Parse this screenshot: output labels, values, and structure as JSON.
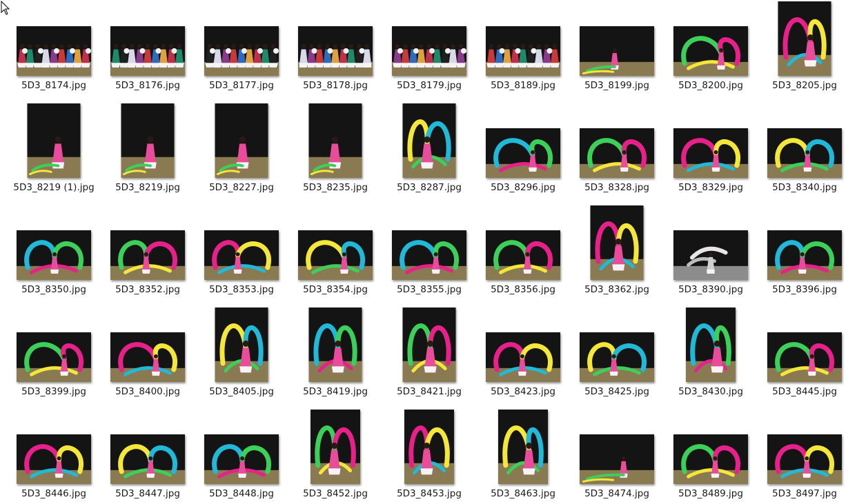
{
  "files": [
    {
      "name": "5D3_8174.jpg",
      "orient": "land",
      "scene": "group"
    },
    {
      "name": "5D3_8176.jpg",
      "orient": "land",
      "scene": "group"
    },
    {
      "name": "5D3_8177.jpg",
      "orient": "land",
      "scene": "group"
    },
    {
      "name": "5D3_8178.jpg",
      "orient": "land",
      "scene": "group"
    },
    {
      "name": "5D3_8179.jpg",
      "orient": "land",
      "scene": "group"
    },
    {
      "name": "5D3_8189.jpg",
      "orient": "land",
      "scene": "group"
    },
    {
      "name": "5D3_8199.jpg",
      "orient": "land",
      "scene": "solo"
    },
    {
      "name": "5D3_8200.jpg",
      "orient": "land",
      "scene": "ribbon"
    },
    {
      "name": "5D3_8205.jpg",
      "orient": "port",
      "scene": "ribbon"
    },
    {
      "name": "5D3_8219 (1).jpg",
      "orient": "port",
      "scene": "solo"
    },
    {
      "name": "5D3_8219.jpg",
      "orient": "port",
      "scene": "solo"
    },
    {
      "name": "5D3_8227.jpg",
      "orient": "port",
      "scene": "solo"
    },
    {
      "name": "5D3_8235.jpg",
      "orient": "port",
      "scene": "solo"
    },
    {
      "name": "5D3_8287.jpg",
      "orient": "port",
      "scene": "ribbon"
    },
    {
      "name": "5D3_8296.jpg",
      "orient": "land",
      "scene": "ribbon"
    },
    {
      "name": "5D3_8328.jpg",
      "orient": "land",
      "scene": "ribbon"
    },
    {
      "name": "5D3_8329.jpg",
      "orient": "land",
      "scene": "ribbon"
    },
    {
      "name": "5D3_8340.jpg",
      "orient": "land",
      "scene": "ribbon"
    },
    {
      "name": "5D3_8350.jpg",
      "orient": "land",
      "scene": "ribbon"
    },
    {
      "name": "5D3_8352.jpg",
      "orient": "land",
      "scene": "ribbon"
    },
    {
      "name": "5D3_8353.jpg",
      "orient": "land",
      "scene": "ribbon"
    },
    {
      "name": "5D3_8354.jpg",
      "orient": "land",
      "scene": "ribbon"
    },
    {
      "name": "5D3_8355.jpg",
      "orient": "land",
      "scene": "ribbon"
    },
    {
      "name": "5D3_8356.jpg",
      "orient": "land",
      "scene": "ribbon"
    },
    {
      "name": "5D3_8362.jpg",
      "orient": "port",
      "scene": "ribbon"
    },
    {
      "name": "5D3_8390.jpg",
      "orient": "land",
      "scene": "bw"
    },
    {
      "name": "5D3_8396.jpg",
      "orient": "land",
      "scene": "ribbon"
    },
    {
      "name": "5D3_8399.jpg",
      "orient": "land",
      "scene": "ribbon"
    },
    {
      "name": "5D3_8400.jpg",
      "orient": "land",
      "scene": "ribbon"
    },
    {
      "name": "5D3_8405.jpg",
      "orient": "port",
      "scene": "ribbon"
    },
    {
      "name": "5D3_8419.jpg",
      "orient": "port",
      "scene": "ribbon"
    },
    {
      "name": "5D3_8421.jpg",
      "orient": "port",
      "scene": "ribbon"
    },
    {
      "name": "5D3_8423.jpg",
      "orient": "land",
      "scene": "ribbon"
    },
    {
      "name": "5D3_8425.jpg",
      "orient": "land",
      "scene": "ribbon"
    },
    {
      "name": "5D3_8430.jpg",
      "orient": "port2",
      "scene": "ribbon"
    },
    {
      "name": "5D3_8445.jpg",
      "orient": "land",
      "scene": "ribbon"
    },
    {
      "name": "5D3_8446.jpg",
      "orient": "land",
      "scene": "ribbon"
    },
    {
      "name": "5D3_8447.jpg",
      "orient": "land",
      "scene": "ribbon"
    },
    {
      "name": "5D3_8448.jpg",
      "orient": "land",
      "scene": "ribbon"
    },
    {
      "name": "5D3_8452.jpg",
      "orient": "port2",
      "scene": "ribbon"
    },
    {
      "name": "5D3_8453.jpg",
      "orient": "port2",
      "scene": "ribbon"
    },
    {
      "name": "5D3_8463.jpg",
      "orient": "port2",
      "scene": "ribbon"
    },
    {
      "name": "5D3_8474.jpg",
      "orient": "land",
      "scene": "solo"
    },
    {
      "name": "5D3_8489.jpg",
      "orient": "land",
      "scene": "ribbon"
    },
    {
      "name": "5D3_8497.jpg",
      "orient": "land",
      "scene": "ribbon"
    }
  ],
  "colors": {
    "backdrop": "#141414",
    "floor": "#8a7a52",
    "ribbon_pink": "#e8208a",
    "ribbon_yellow": "#f5e63a",
    "ribbon_cyan": "#22b8d8",
    "ribbon_green": "#3ccf5a",
    "costume_pink": "#e84c9a",
    "label_text": "#1a1a1a"
  },
  "icons": {
    "cursor": "mouse-pointer-icon"
  }
}
